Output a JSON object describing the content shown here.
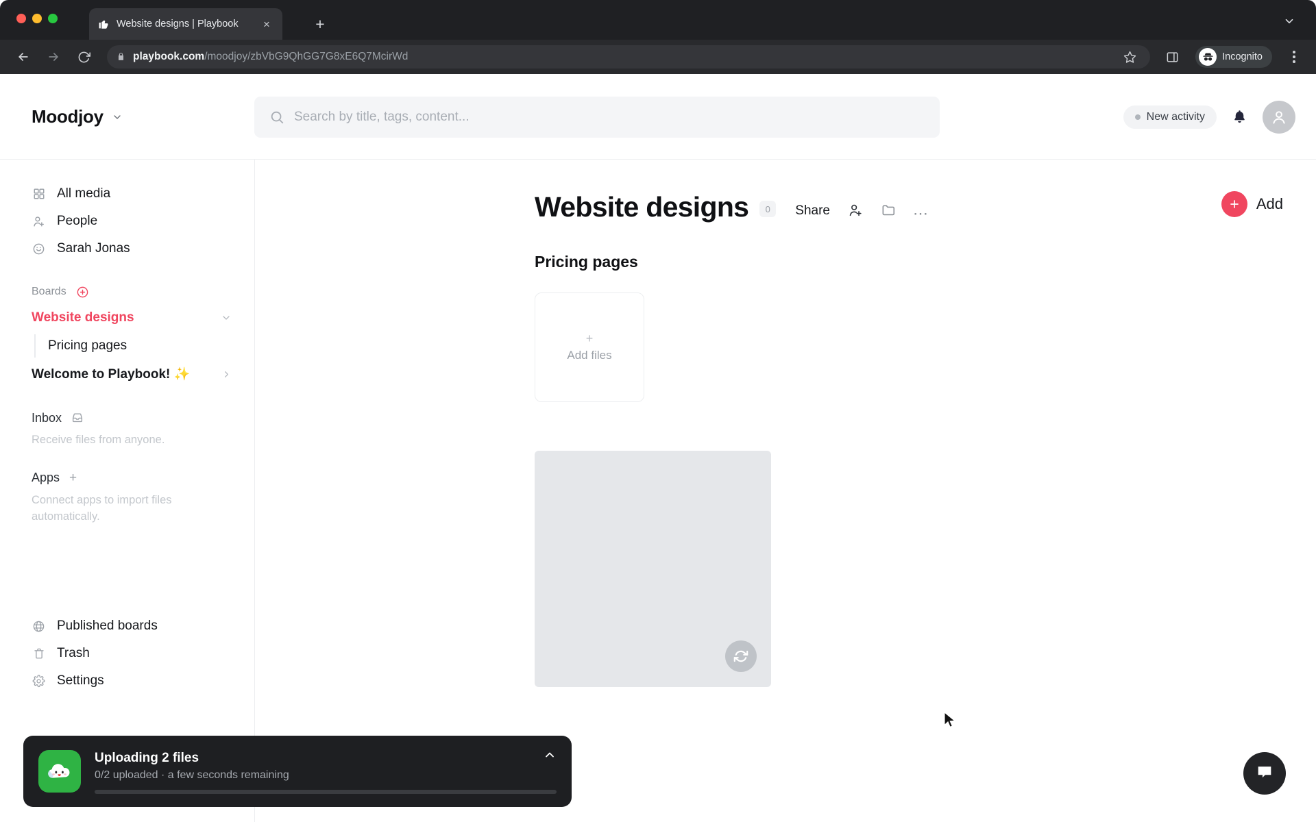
{
  "browser": {
    "tab": {
      "title": "Website designs | Playbook",
      "favicon": "thumbs-up-icon",
      "close": "×"
    },
    "new_tab_label": "+",
    "omnibox": {
      "host": "playbook.com",
      "path": "/moodjoy/zbVbG9QhGG7G8xE6Q7McirWd",
      "lock": "lock-icon"
    },
    "profile_label": "Incognito",
    "icons": {
      "back": "back-arrow-icon",
      "forward": "forward-arrow-icon",
      "reload": "reload-icon",
      "bookmark": "star-icon",
      "side_panel": "side-panel-icon",
      "menu": "kebab-menu-icon",
      "tab_list": "chevron-down-icon"
    }
  },
  "topbar": {
    "brand": "Moodjoy",
    "search_placeholder": "Search by title, tags, content...",
    "search_value": "",
    "activity_label": "New activity",
    "notifications": "bell-icon",
    "avatar": "user-avatar"
  },
  "sidebar": {
    "nav": [
      {
        "label": "All media",
        "icon": "grid-icon"
      },
      {
        "label": "People",
        "icon": "person-add-icon"
      },
      {
        "label": "Sarah Jonas",
        "icon": "smiley-icon"
      }
    ],
    "boards_label": "Boards",
    "boards_add": "circle-plus-icon",
    "boards": [
      {
        "label": "Website designs",
        "active": true,
        "chevron": "chevron-down-icon"
      },
      {
        "label": "Welcome to Playbook! ✨",
        "active": false,
        "chevron": "chevron-right-icon"
      }
    ],
    "board_child": "Pricing pages",
    "inbox_label": "Inbox",
    "inbox_icon": "tray-icon",
    "inbox_hint": "Receive files from anyone.",
    "apps_label": "Apps",
    "apps_add": "plus-icon",
    "apps_hint": "Connect apps to import files automatically.",
    "bottom": [
      {
        "label": "Published boards",
        "icon": "globe-icon"
      },
      {
        "label": "Trash",
        "icon": "trash-icon"
      },
      {
        "label": "Settings",
        "icon": "gear-icon"
      }
    ]
  },
  "main": {
    "title": "Website designs",
    "count": "0",
    "share_label": "Share",
    "invite_icon": "person-add-icon",
    "folder_icon": "folder-icon",
    "more_icon": "ellipsis-icon",
    "add_label": "Add",
    "section_title": "Pricing pages",
    "add_files_label": "Add files",
    "add_files_plus": "+",
    "tile_badge_icon": "sync-icon"
  },
  "toast": {
    "app_icon": "cloud-face-icon",
    "title": "Uploading 2 files",
    "subtitle": "0/2 uploaded  ·  a few seconds remaining",
    "progress_percent": 0,
    "collapse_icon": "chevron-up-icon"
  },
  "chat": {
    "icon": "chat-bubble-icon"
  },
  "colors": {
    "accent": "#f0465f",
    "chrome_bg": "#1f2023",
    "toast_bg": "#1e1f22",
    "toast_app_green": "#2fb344",
    "tile_gray": "#e5e7ea"
  }
}
